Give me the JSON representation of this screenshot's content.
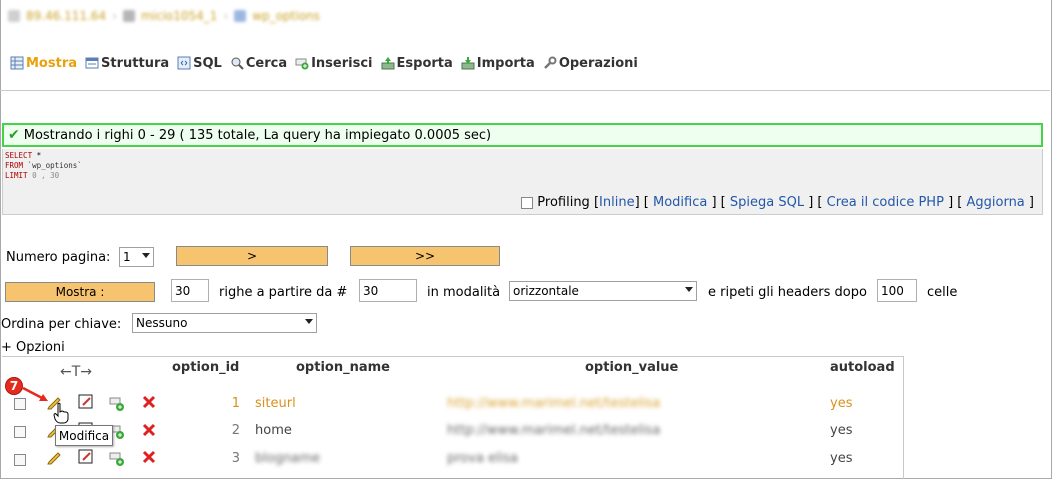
{
  "breadcrumb": {
    "server": "89.46.111.64",
    "database": "micio1054_1",
    "table": "wp_options"
  },
  "tabs": [
    {
      "label": "Mostra",
      "icon": "browse-icon",
      "active": true
    },
    {
      "label": "Struttura",
      "icon": "structure-icon"
    },
    {
      "label": "SQL",
      "icon": "sql-icon"
    },
    {
      "label": "Cerca",
      "icon": "search-icon"
    },
    {
      "label": "Inserisci",
      "icon": "insert-icon"
    },
    {
      "label": "Esporta",
      "icon": "export-icon"
    },
    {
      "label": "Importa",
      "icon": "import-icon"
    },
    {
      "label": "Operazioni",
      "icon": "operations-icon"
    }
  ],
  "message": {
    "text": "Mostrando i righi 0 - 29 ( 135 totale, La query ha impiegato 0.0005 sec)",
    "color": "#46d346"
  },
  "sql": {
    "line1_kw": "SELECT",
    "line1_rest": " *",
    "line2_kw": "FROM",
    "line2_rest": " `wp_options`",
    "line3_kw": "LIMIT",
    "line3_rest": " 0 , 30"
  },
  "sql_links": {
    "profiling": "Profiling",
    "inline": "Inline",
    "modifica": "Modifica",
    "spiega": "Spiega SQL",
    "crea": "Crea il codice PHP",
    "aggiorna": "Aggiorna"
  },
  "nav": {
    "page_label": "Numero pagina:",
    "page_value": "1",
    "next_label": ">",
    "last_label": ">>",
    "show_button": "Mostra :",
    "rows_value": "30",
    "rows_from_label": "righe a partire da #",
    "start_value": "30",
    "mode_label": "in modalità",
    "mode_value": "orizzontale",
    "repeat_label": "e ripeti gli headers dopo",
    "repeat_value": "100",
    "cells_label": "celle",
    "sort_label": "Ordina per chiave:",
    "sort_value": "Nessuno",
    "options_link": "+ Opzioni"
  },
  "table": {
    "columns": [
      "option_id",
      "option_name",
      "option_value",
      "autoload"
    ],
    "rows": [
      {
        "id": "1",
        "name": "siteurl",
        "value": "http://www.marimel.net/testelisa",
        "autoload": "yes"
      },
      {
        "id": "2",
        "name": "home",
        "value": "http://www.marimel.net/testelisa",
        "autoload": "yes"
      },
      {
        "id": "3",
        "name": "blogname",
        "value": "prova elisa",
        "autoload": "yes"
      }
    ]
  },
  "annotation": {
    "badge": "7",
    "tooltip": "Modifica"
  },
  "colors": {
    "accent": "#e8a10c",
    "button": "#f6c46f",
    "link": "#2357a8",
    "delete": "#e02020"
  }
}
